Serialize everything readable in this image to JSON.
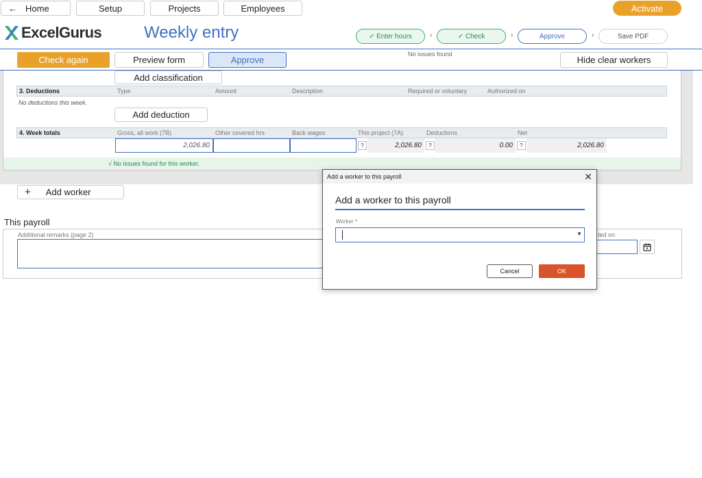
{
  "nav": {
    "home": "Home",
    "setup": "Setup",
    "projects": "Projects",
    "employees": "Employees",
    "activate": "Activate"
  },
  "brand": {
    "logo_text": "ExcelGurus"
  },
  "page_title": "Weekly entry",
  "steps": [
    {
      "label": "✓ Enter hours",
      "state": "done"
    },
    {
      "label": "✓ Check",
      "state": "done"
    },
    {
      "label": "Approve",
      "state": "current"
    },
    {
      "label": "Save PDF",
      "state": "todo"
    }
  ],
  "toolbar": {
    "check_again": "Check again",
    "preview_form": "Preview form",
    "approve": "Approve",
    "status": "No issues found",
    "hide_clear_workers": "Hide clear workers"
  },
  "worker_panel": {
    "add_classification": "Add classification",
    "deductions": {
      "title": "3. Deductions",
      "columns": [
        "Type",
        "Amount",
        "Description",
        "Required or voluntary",
        "Authorized on"
      ],
      "empty_note": "No deductions this week.",
      "add_button": "Add deduction"
    },
    "week_totals": {
      "title": "4. Week totals",
      "columns": [
        "Gross, all work (7B)",
        "Other covered hrs",
        "Back wages",
        "This project (7A)",
        "Deductions",
        "Net"
      ],
      "gross": "2,026.80",
      "other_covered": "",
      "back_wages": "",
      "this_project": "2,026.80",
      "deductions": "0.00",
      "net": "2,026.80",
      "help": "?"
    },
    "ok_message": "√  No issues found for this worker."
  },
  "add_worker_button": "Add worker",
  "this_payroll": {
    "title": "This payroll",
    "remarks_label": "Additional remarks (page 2)",
    "authorized_label_visible": "ted on"
  },
  "dialog": {
    "titlebar": "Add a worker to this payroll",
    "heading": "Add a worker to this payroll",
    "worker_label": "Worker *",
    "worker_value": "",
    "cancel": "Cancel",
    "ok": "OK"
  },
  "colors": {
    "accent_orange": "#e8a22a",
    "accent_blue": "#3f6fbf",
    "success_green": "#2a8a4a",
    "danger_orange": "#d9532b"
  }
}
